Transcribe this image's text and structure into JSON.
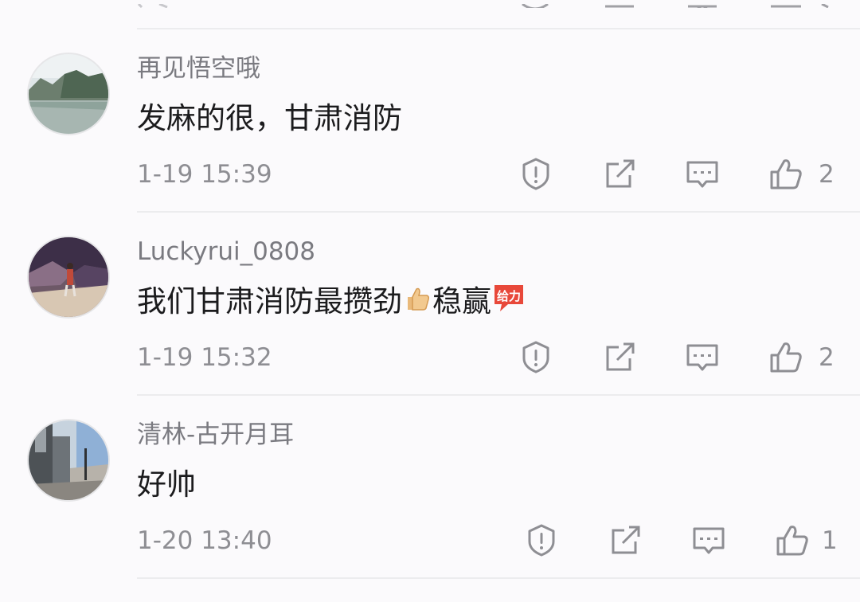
{
  "comments": [
    {
      "username": "再见悟空哦",
      "text": "发麻的很，甘肃消防",
      "timestamp": "1-19 15:39",
      "likes": "2",
      "avatar": "avatar-landscape-lake"
    },
    {
      "username": "Luckyrui_0808",
      "text_before": "我们甘肃消防最攒劲",
      "emoji_1": "thumbs-up-emoji",
      "text_middle": "稳赢",
      "emoji_2": "jiayou-sticker",
      "emoji_2_text": "给力",
      "timestamp": "1-19 15:32",
      "likes": "2",
      "avatar": "avatar-person-garden"
    },
    {
      "username": "清林-古开月耳",
      "text": "好帅",
      "timestamp": "1-20 13:40",
      "likes": "1",
      "avatar": "avatar-street-photo"
    }
  ],
  "actions": [
    "report-icon",
    "share-icon",
    "reply-icon",
    "like-icon"
  ],
  "colors": {
    "background": "#fbfafc",
    "text_primary": "#1b1b1d",
    "text_secondary": "#7a7a80",
    "icon": "#8e8e93",
    "divider": "#ececee",
    "sticker_red": "#e8483a"
  }
}
